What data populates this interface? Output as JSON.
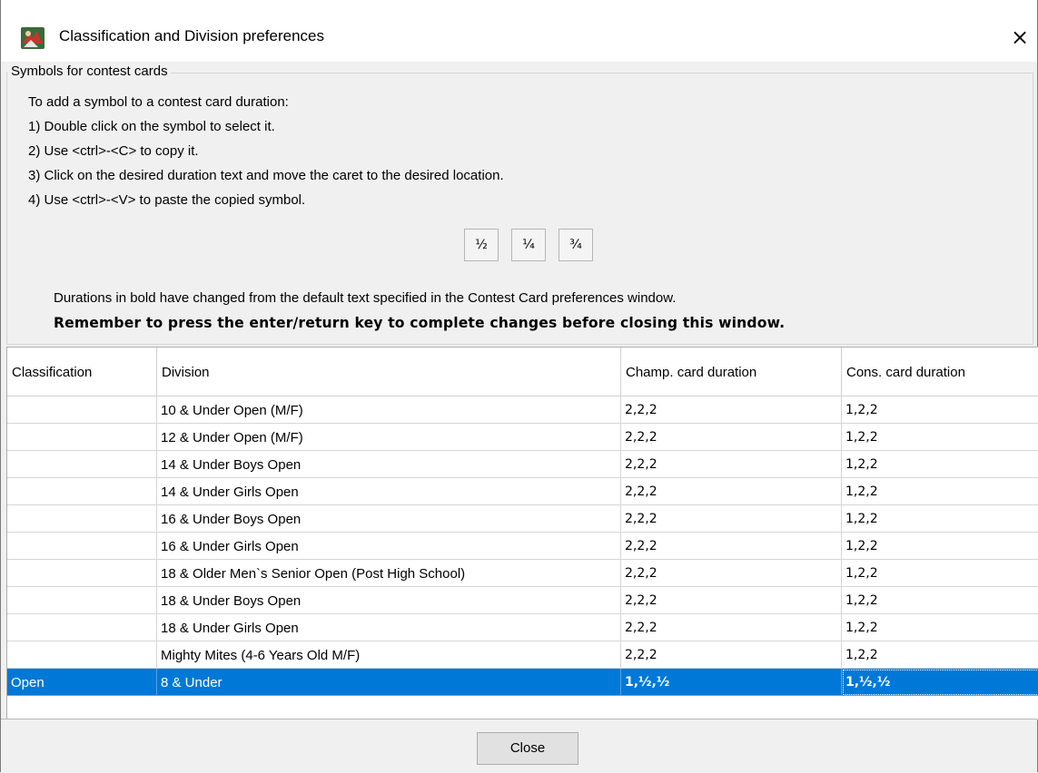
{
  "window": {
    "title": "Classification and Division preferences",
    "close_glyph": "×"
  },
  "symbols": {
    "legend": "Symbols for contest cards",
    "instructions": [
      "To add a symbol to a contest card duration:",
      "1) Double click on the symbol to select it.",
      "2) Use <ctrl>-<C> to copy it.",
      "3) Click on the desired duration text and move the caret to the desired location.",
      "4) Use <ctrl>-<V> to paste the copied symbol."
    ],
    "buttons": [
      "½",
      "¼",
      "¾"
    ],
    "note": "Durations in bold have changed from the default text specified in the Contest Card preferences window.",
    "note_bold": "Remember to press the enter/return key to complete changes before closing this window."
  },
  "table": {
    "columns": [
      "Classification",
      "Division",
      "Champ. card duration",
      "Cons. card duration"
    ],
    "rows": [
      {
        "classification": "",
        "division": "10 & Under Open (M/F)",
        "champ": "2,2,2",
        "cons": "1,2,2"
      },
      {
        "classification": "",
        "division": "12 & Under Open (M/F)",
        "champ": "2,2,2",
        "cons": "1,2,2"
      },
      {
        "classification": "",
        "division": "14 & Under Boys Open",
        "champ": "2,2,2",
        "cons": "1,2,2"
      },
      {
        "classification": "",
        "division": "14 & Under Girls Open",
        "champ": "2,2,2",
        "cons": "1,2,2"
      },
      {
        "classification": "",
        "division": "16 & Under Boys Open",
        "champ": "2,2,2",
        "cons": "1,2,2"
      },
      {
        "classification": "",
        "division": "16 & Under Girls Open",
        "champ": "2,2,2",
        "cons": "1,2,2"
      },
      {
        "classification": "",
        "division": "18 & Older Men`s Senior Open (Post High School)",
        "champ": "2,2,2",
        "cons": "1,2,2"
      },
      {
        "classification": "",
        "division": "18 & Under Boys Open",
        "champ": "2,2,2",
        "cons": "1,2,2"
      },
      {
        "classification": "",
        "division": "18 & Under Girls Open",
        "champ": "2,2,2",
        "cons": "1,2,2"
      },
      {
        "classification": "",
        "division": "Mighty Mites (4-6 Years Old M/F)",
        "champ": "2,2,2",
        "cons": "1,2,2"
      },
      {
        "classification": "Open",
        "division": "8 & Under",
        "champ": "1,½,½",
        "cons": "1,½,½",
        "selected": true
      }
    ]
  },
  "footer": {
    "close_label": "Close"
  },
  "colors": {
    "selection": "#0078d7",
    "window_bg": "#f0f0f0"
  }
}
